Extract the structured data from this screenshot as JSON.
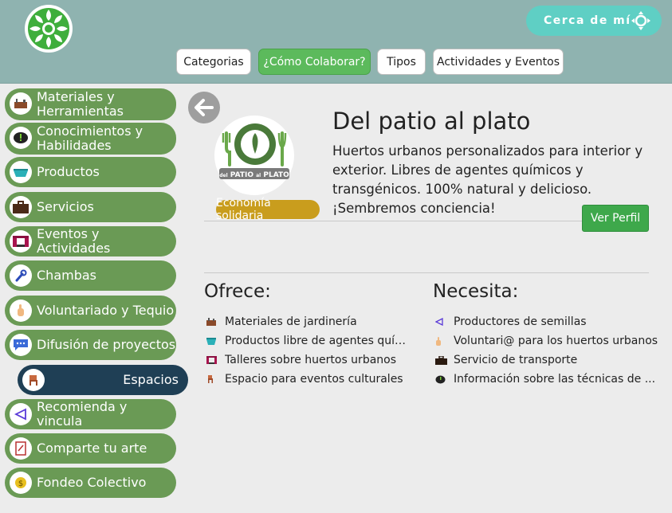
{
  "header": {
    "near_button": "Cerca de mí",
    "nav": [
      {
        "label": "Categorias",
        "active": false
      },
      {
        "label": "¿Cómo Colaborar?",
        "active": true
      },
      {
        "label": "Tipos",
        "active": false
      },
      {
        "label": "Actividades y Eventos",
        "active": false
      }
    ]
  },
  "sidebar": {
    "items": [
      {
        "label": "Materiales y Herramientas",
        "icon": "tools-icon"
      },
      {
        "label": "Conocimientos y Habilidades",
        "icon": "thought-bubble-icon"
      },
      {
        "label": "Productos",
        "icon": "basket-icon"
      },
      {
        "label": "Servicios",
        "icon": "briefcase-icon"
      },
      {
        "label": "Eventos y Actividades",
        "icon": "stage-icon"
      },
      {
        "label": "Chambas",
        "icon": "wrench-icon"
      },
      {
        "label": "Voluntariado y Tequio",
        "icon": "hand-icon"
      },
      {
        "label": "Difusión de proyectos",
        "icon": "chat-icon"
      },
      {
        "label": "Espacios",
        "icon": "chair-icon"
      },
      {
        "label": "Recomienda y vincula",
        "icon": "share-icon"
      },
      {
        "label": "Comparte tu arte",
        "icon": "artwork-icon"
      },
      {
        "label": "Fondeo Colectivo",
        "icon": "coin-icon"
      }
    ],
    "active_index": 8
  },
  "profile": {
    "title": "Del patio al plato",
    "description": "Huertos urbanos personalizados para interior y exterior. Libres de agentes químicos y transgénicos. 100% natural y delicioso. ¡Sembremos conciencia!",
    "badge": "Economía solidaria",
    "logo_text_left": "del",
    "logo_text_main": "PATIO",
    "logo_text_mid": "al",
    "logo_text_end": "PLATO",
    "view_profile": "Ver Perfil"
  },
  "offers": {
    "title": "Ofrece:",
    "items": [
      {
        "icon": "tools-icon",
        "text": "Materiales de jardinería"
      },
      {
        "icon": "basket-icon",
        "text": "Productos libre de agentes químic..."
      },
      {
        "icon": "stage-icon",
        "text": "Talleres sobre huertos urbanos"
      },
      {
        "icon": "chair-icon",
        "text": "Espacio para eventos culturales"
      }
    ]
  },
  "needs": {
    "title": "Necesita:",
    "items": [
      {
        "icon": "share-icon",
        "text": "Productores de semillas"
      },
      {
        "icon": "hand-icon",
        "text": "Voluntari@ para los huertos urbanos"
      },
      {
        "icon": "briefcase-icon",
        "text": "Servicio de transporte"
      },
      {
        "icon": "thought-bubble-icon",
        "text": "Información sobre las técnicas de ..."
      }
    ]
  },
  "colors": {
    "header_bg": "#8fb3b0",
    "sidebar_item": "#6a9a55",
    "sidebar_active": "#1f3f55",
    "nav_active": "#5cba5c",
    "near_button": "#5fcfc4",
    "badge": "#c99d1d",
    "profile_button": "#3ea84b"
  }
}
